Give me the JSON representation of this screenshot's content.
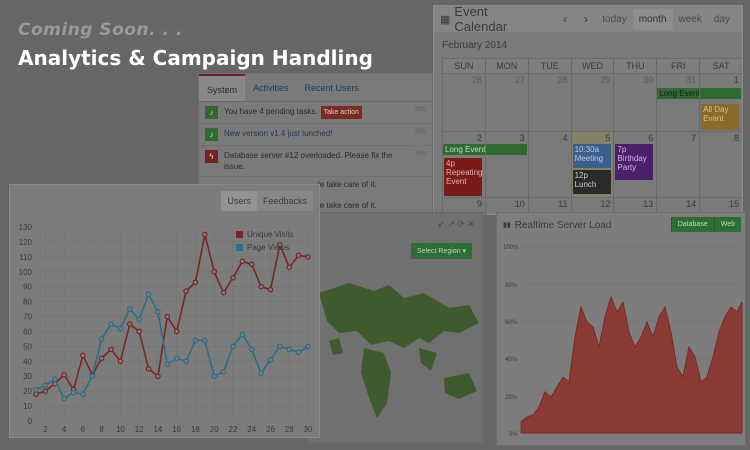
{
  "hero": {
    "coming_soon": "Coming Soon. . .",
    "title": "Analytics & Campaign Handling"
  },
  "calendar": {
    "title": "Event Calendar",
    "prev": "‹",
    "next": "›",
    "views": [
      "today",
      "month",
      "week",
      "day"
    ],
    "active_view": "month",
    "month_label": "February 2014",
    "dow": [
      "SUN",
      "MON",
      "TUE",
      "WED",
      "THU",
      "FRI",
      "SAT"
    ],
    "week1": [
      "26",
      "27",
      "28",
      "29",
      "30",
      "31",
      "1"
    ],
    "week2": [
      "2",
      "3",
      "4",
      "5",
      "6",
      "7",
      "8"
    ],
    "week3": [
      "9",
      "10",
      "11",
      "12",
      "13",
      "14",
      "15"
    ],
    "events": {
      "long_event_1": "Long Event",
      "all_day": "All Day Event",
      "long_event_2": "Long Event",
      "repeating": "4p Repeating Event",
      "meeting": "10:30a Meeting",
      "lunch": "12p Lunch",
      "birthday": "7p Birthday Party"
    },
    "colors": {
      "green": "#2f6a30",
      "orange": "#8a6a2a",
      "red": "#7a1a1a",
      "blue": "#3b5f8a",
      "black": "#2a2a2a",
      "purple": "#4b1f6a"
    }
  },
  "tasks_panel": {
    "tabs": [
      "System",
      "Activities",
      "Recent Users"
    ],
    "items": [
      {
        "icon": "bell-icon",
        "text": "You have 4 pending tasks.",
        "action": "Take action",
        "time": "30s",
        "color": "#2f6a30",
        "link": false
      },
      {
        "icon": "bell-icon",
        "text": "New version v1.4 just lunched!",
        "time": "25s",
        "color": "#2f6a30",
        "link": true
      },
      {
        "icon": "bolt-icon",
        "text": "Database server #12 overloaded. Please fix the issue.",
        "time": "24s",
        "color": "#7a2020",
        "link": false
      }
    ],
    "partial_1": "le take care of it.",
    "partial_2": "le take care of it."
  },
  "line_chart": {
    "tabs": [
      "Users",
      "Feedbacks"
    ],
    "active_tab": "Users"
  },
  "chart_data": {
    "type": "line",
    "title": "",
    "xlabel": "",
    "ylabel": "",
    "x": [
      1,
      2,
      3,
      4,
      5,
      6,
      7,
      8,
      9,
      10,
      11,
      12,
      13,
      14,
      15,
      16,
      17,
      18,
      19,
      20,
      21,
      22,
      23,
      24,
      25,
      26,
      27,
      28,
      29,
      30
    ],
    "xticks": [
      2,
      4,
      6,
      8,
      10,
      12,
      14,
      16,
      18,
      20,
      22,
      24,
      26,
      28,
      30
    ],
    "yticks": [
      0,
      10,
      20,
      30,
      40,
      50,
      60,
      70,
      80,
      90,
      100,
      110,
      120,
      130
    ],
    "ylim": [
      0,
      130
    ],
    "xlim": [
      1,
      30
    ],
    "grid": true,
    "legend": "top-right",
    "series": [
      {
        "name": "Unique Visits",
        "color": "#7a2424",
        "values": [
          18,
          20,
          25,
          31,
          21,
          44,
          31,
          42,
          48,
          40,
          65,
          60,
          35,
          30,
          70,
          60,
          87,
          93,
          125,
          100,
          86,
          96,
          107,
          105,
          90,
          88,
          118,
          103,
          111,
          110
        ]
      },
      {
        "name": "Page Views",
        "color": "#2a6e8a",
        "values": [
          21,
          24,
          28,
          15,
          19,
          18,
          30,
          55,
          65,
          62,
          75,
          68,
          85,
          73,
          38,
          42,
          40,
          54,
          54,
          30,
          33,
          50,
          58,
          48,
          32,
          41,
          50,
          48,
          46,
          50
        ]
      }
    ]
  },
  "map_panel": {
    "region_button": "Select Region ▾",
    "controls": "↙ ↗ ⟳ ✕"
  },
  "server_panel": {
    "title": "Realtime Server Load",
    "buttons": [
      "Database",
      "Web"
    ],
    "yticks": [
      "100%",
      "80%",
      "60%",
      "40%",
      "20%",
      "0%"
    ],
    "load_color": "#8a3a34"
  }
}
